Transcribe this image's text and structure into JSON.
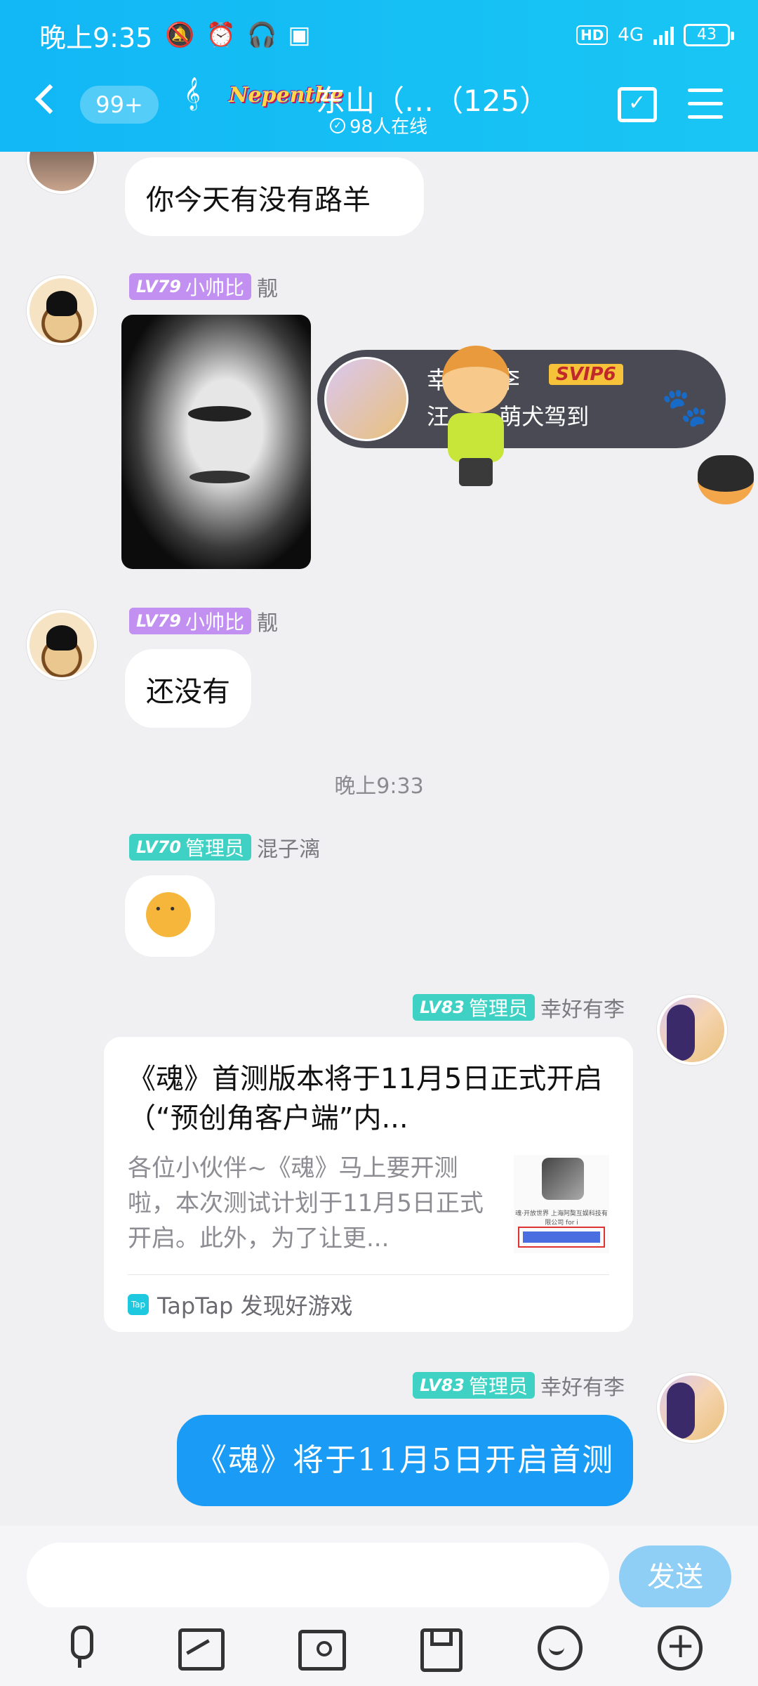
{
  "status_bar": {
    "time": "晚上9:35",
    "left_icons": [
      "mute-icon",
      "alarm-icon",
      "headset-icon",
      "app-icon"
    ],
    "hd": "HD",
    "network": "4G",
    "battery": "43"
  },
  "header": {
    "unread_count": "99+",
    "group_badge": "Nepenthe",
    "group_name": "东山（…（125）",
    "online_count": "98人在线",
    "colors": {
      "gradient_start": "#12b7f5",
      "gradient_end": "#19c6f4"
    }
  },
  "messages": [
    {
      "type": "text",
      "side": "left",
      "text": "你今天有没有路羊"
    },
    {
      "type": "image",
      "side": "left",
      "level": "LV79",
      "title": "小帅比",
      "name": "靓"
    },
    {
      "type": "text",
      "side": "left",
      "level": "LV79",
      "title": "小帅比",
      "name": "靓",
      "text": "还没有"
    },
    {
      "type": "timestamp",
      "text": "晚上9:33"
    },
    {
      "type": "emoji",
      "side": "left",
      "level": "LV70",
      "title": "管理员",
      "name": "混子漓"
    },
    {
      "type": "card",
      "side": "right",
      "level": "LV83",
      "title": "管理员",
      "name": "幸好有李",
      "card_title": "《魂》首测版本将于11月5日正式开启（“预创角客户端”内...",
      "card_desc": "各位小伙伴~《魂》马上要开测啦，本次测试计划于11月5日正式开启。此外，为了让更...",
      "thumb_line": "魂·开放世界 上海阿獒互娱科技有限公司 for i",
      "source_icon": "Tap",
      "source": "TapTap 发现好游戏"
    },
    {
      "type": "text",
      "side": "right",
      "level": "LV83",
      "title": "管理员",
      "name": "幸好有李",
      "text": "《魂》将于11月5日开启首测"
    }
  ],
  "banner": {
    "name_start": "幸",
    "name_end": "李",
    "vip": "SVIP6",
    "msg_start": "汪",
    "msg_end": "萌犬驾到"
  },
  "input": {
    "placeholder": "",
    "send_label": "发送"
  },
  "toolbar": [
    "mic-icon",
    "image-icon",
    "camera-icon",
    "file-icon",
    "emoji-icon",
    "plus-icon"
  ]
}
